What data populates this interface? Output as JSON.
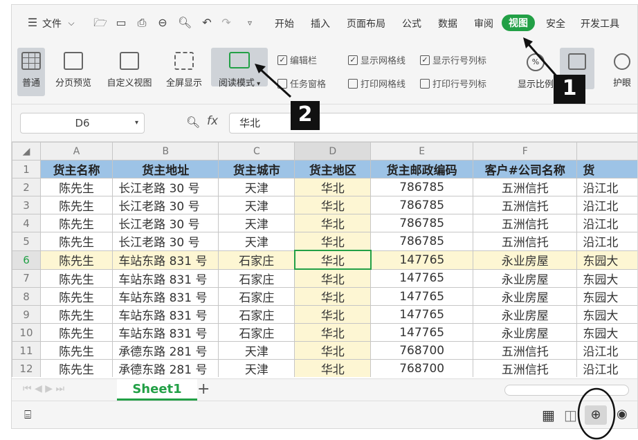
{
  "menu": {
    "file": "文件",
    "tabs": [
      "开始",
      "插入",
      "页面布局",
      "公式",
      "数据",
      "审阅",
      "视图",
      "安全",
      "开发工具"
    ],
    "active_tab": "视图"
  },
  "ribbon": {
    "buttons": [
      "普通",
      "分页预览",
      "自定义视图",
      "全屏显示",
      "阅读模式"
    ],
    "checkboxes": [
      {
        "label": "编辑栏",
        "checked": true
      },
      {
        "label": "任务窗格",
        "checked": false
      },
      {
        "label": "显示网格线",
        "checked": true
      },
      {
        "label": "打印网格线",
        "checked": false
      },
      {
        "label": "显示行号列标",
        "checked": true
      },
      {
        "label": "打印行号列标",
        "checked": false
      }
    ],
    "zoom_label": "显示比例",
    "right_label": "护眼"
  },
  "formula_bar": {
    "cell_ref": "D6",
    "fx": "fx",
    "value": "华北"
  },
  "sheet": {
    "columns": [
      "A",
      "B",
      "C",
      "D",
      "E",
      "F"
    ],
    "headers": [
      "货主名称",
      "货主地址",
      "货主城市",
      "货主地区",
      "货主邮政编码",
      "客户#公司名称",
      "货"
    ],
    "rows": [
      [
        "陈先生",
        "长江老路 30 号",
        "天津",
        "华北",
        "786785",
        "五洲信托",
        "沿江北"
      ],
      [
        "陈先生",
        "长江老路 30 号",
        "天津",
        "华北",
        "786785",
        "五洲信托",
        "沿江北"
      ],
      [
        "陈先生",
        "长江老路 30 号",
        "天津",
        "华北",
        "786785",
        "五洲信托",
        "沿江北"
      ],
      [
        "陈先生",
        "长江老路 30 号",
        "天津",
        "华北",
        "786785",
        "五洲信托",
        "沿江北"
      ],
      [
        "陈先生",
        "车站东路 831 号",
        "石家庄",
        "华北",
        "147765",
        "永业房屋",
        "东园大"
      ],
      [
        "陈先生",
        "车站东路 831 号",
        "石家庄",
        "华北",
        "147765",
        "永业房屋",
        "东园大"
      ],
      [
        "陈先生",
        "车站东路 831 号",
        "石家庄",
        "华北",
        "147765",
        "永业房屋",
        "东园大"
      ],
      [
        "陈先生",
        "车站东路 831 号",
        "石家庄",
        "华北",
        "147765",
        "永业房屋",
        "东园大"
      ],
      [
        "陈先生",
        "车站东路 831 号",
        "石家庄",
        "华北",
        "147765",
        "永业房屋",
        "东园大"
      ],
      [
        "陈先生",
        "承德东路 281 号",
        "天津",
        "华北",
        "768700",
        "五洲信托",
        "沿江北"
      ],
      [
        "陈先生",
        "承德东路 281 号",
        "天津",
        "华北",
        "768700",
        "五洲信托",
        "沿江北"
      ]
    ],
    "active_row": 6,
    "active_col": "D",
    "sheet_tab": "Sheet1",
    "add_tab": "+"
  },
  "callouts": [
    "1",
    "2"
  ],
  "colors": {
    "accent": "#22a046",
    "header_fill": "#9dc3e6",
    "highlight": "#fdf6d3"
  }
}
